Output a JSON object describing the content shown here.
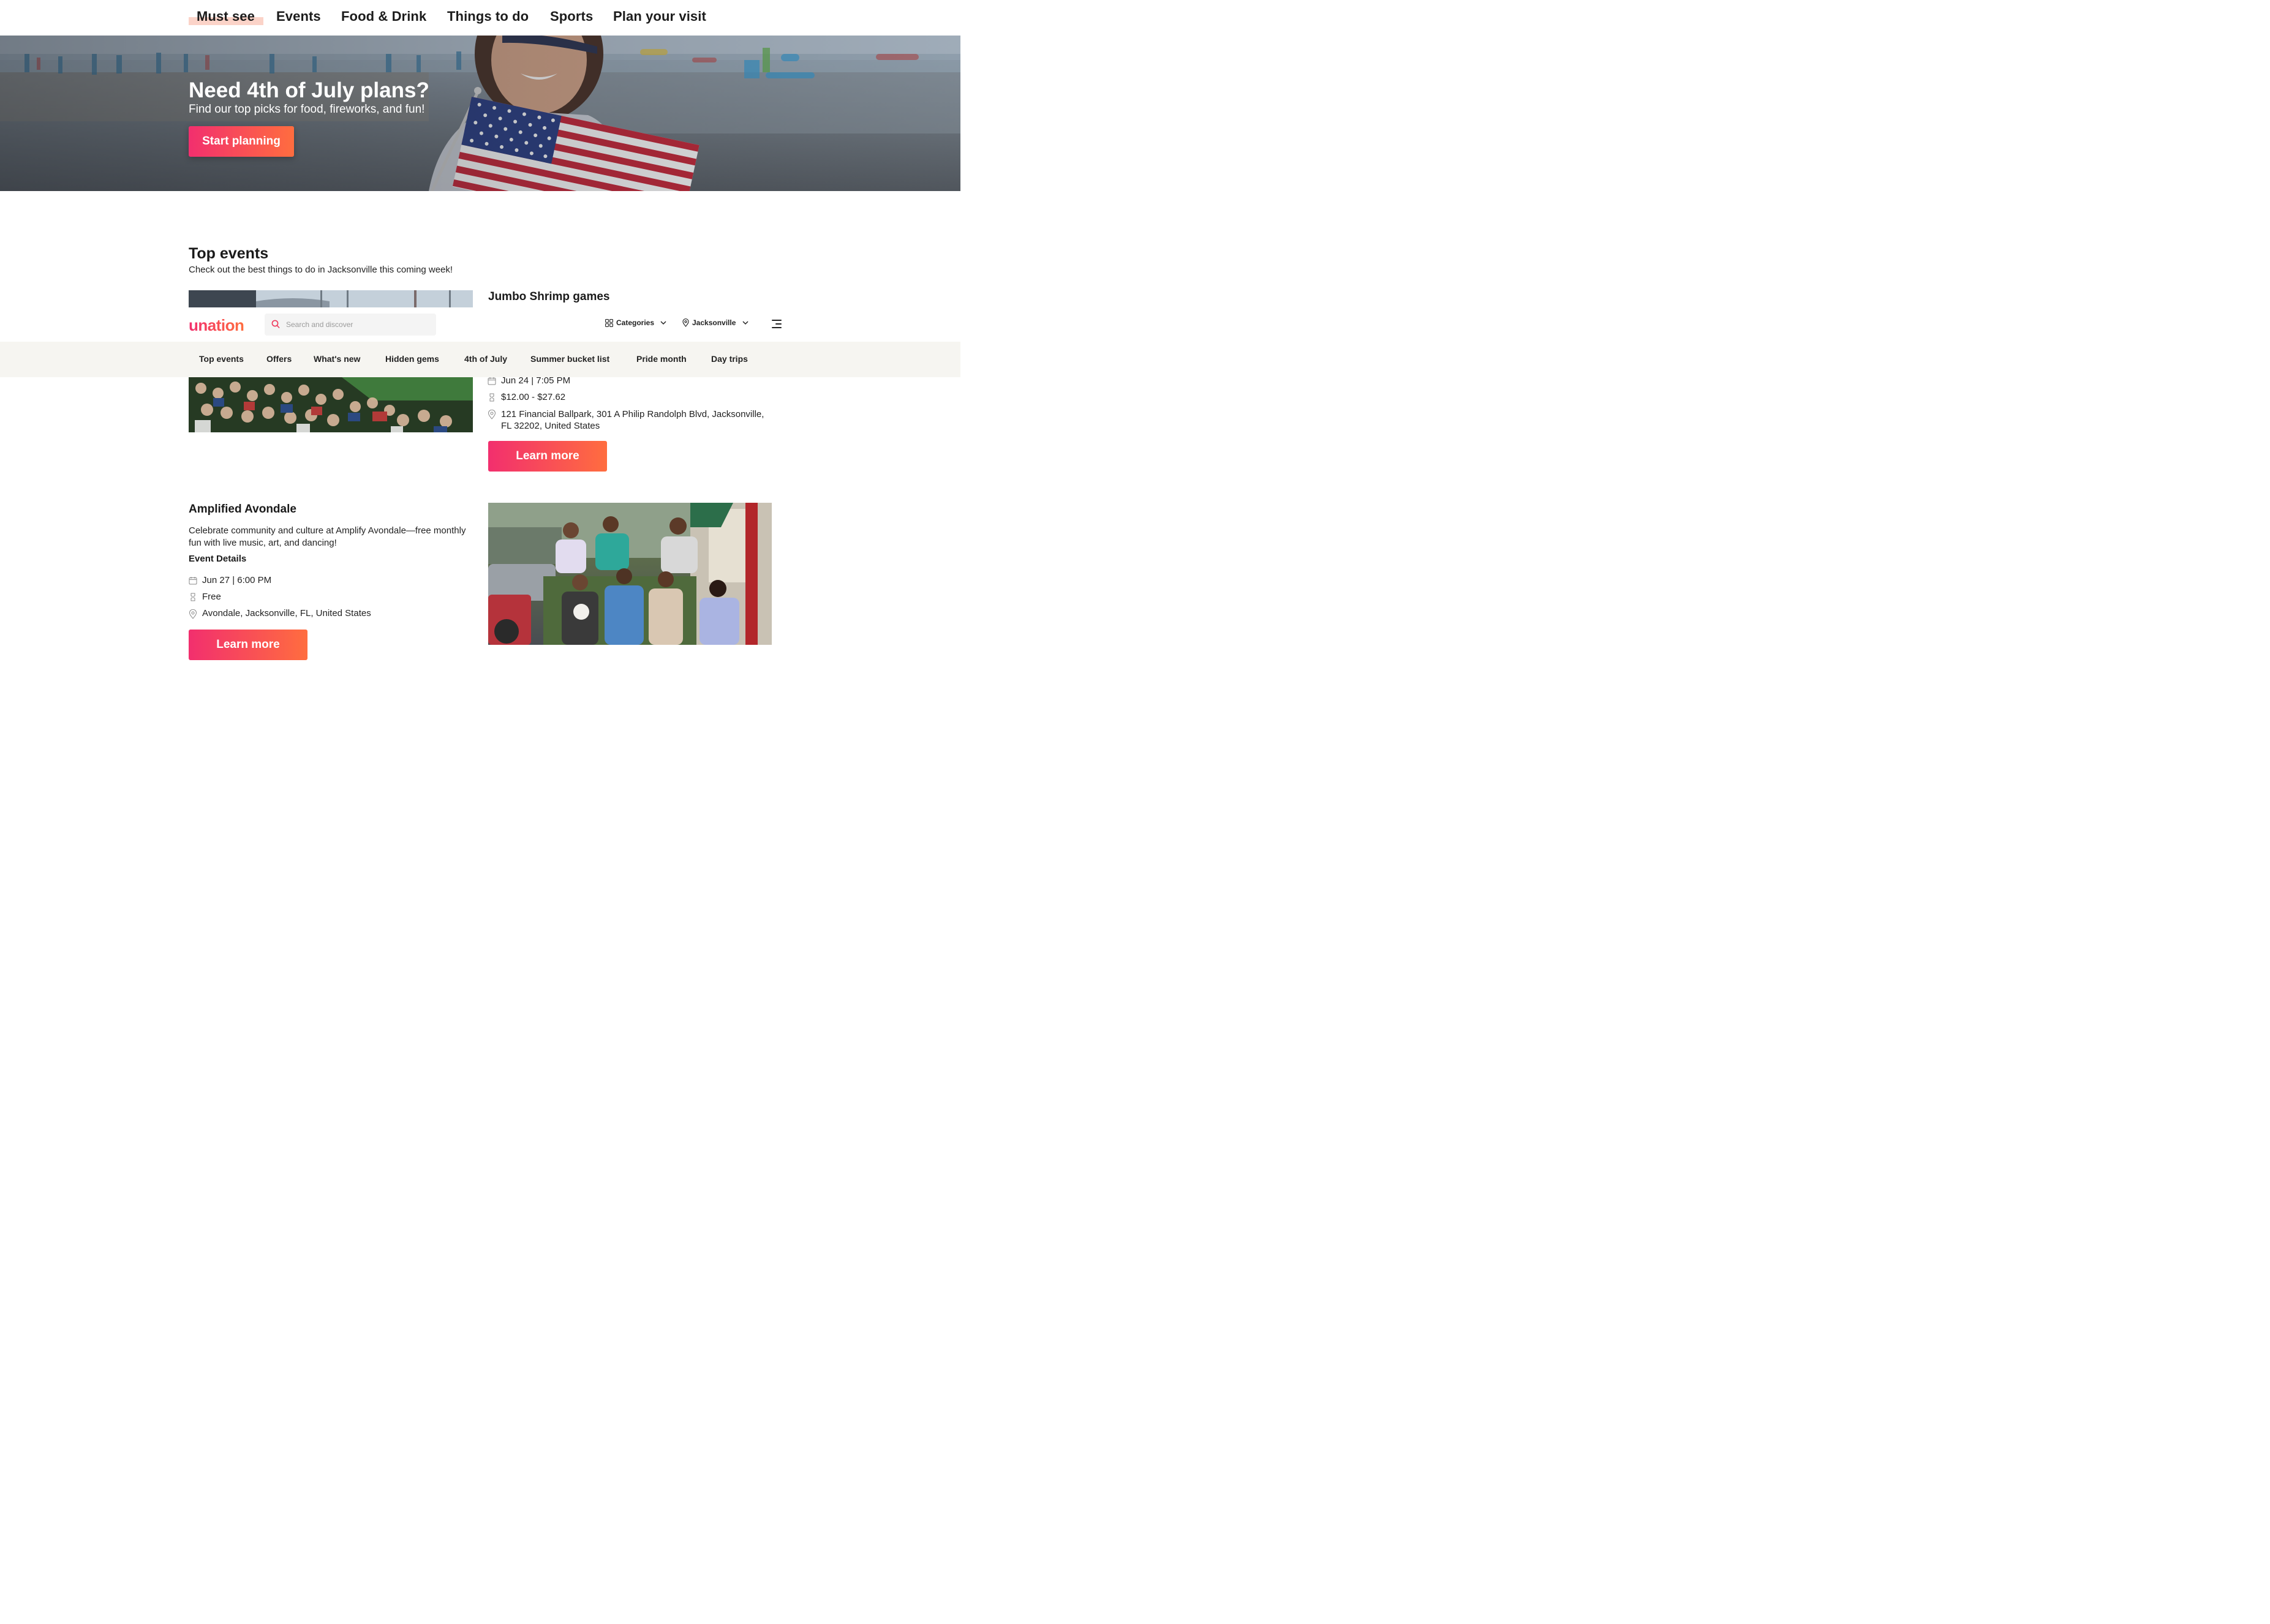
{
  "top_nav": {
    "items": [
      {
        "label": "Must see",
        "active": true
      },
      {
        "label": "Events"
      },
      {
        "label": "Food & Drink"
      },
      {
        "label": "Things to do"
      },
      {
        "label": "Sports"
      },
      {
        "label": "Plan your visit"
      }
    ]
  },
  "hero": {
    "title": "Need 4th of July plans?",
    "subtitle": "Find our top picks for food, fireworks, and fun!",
    "cta_label": "Start planning"
  },
  "header": {
    "logo_text": "unation",
    "search_placeholder": "Search and discover",
    "categories_label": "Categories",
    "location_label": "Jacksonville",
    "brand_gradient": [
      "#f22f6e",
      "#ff6d3f"
    ]
  },
  "sub_nav": {
    "items": [
      "Top events",
      "Offers",
      "What's new",
      "Hidden gems",
      "4th of July",
      "Summer bucket list",
      "Pride month",
      "Day trips"
    ]
  },
  "top_events": {
    "title": "Top events",
    "subtitle": "Check out the best things to do in Jacksonville this coming week!",
    "events": [
      {
        "title": "Jumbo Shrimp games",
        "date": "Jun 24 | 7:05 PM",
        "price": "$12.00 - $27.62",
        "location": "121 Financial Ballpark, 301 A Philip Randolph Blvd, Jacksonville, FL 32202, United States",
        "cta_label": "Learn more"
      },
      {
        "title": "Amplified Avondale",
        "description": "Celebrate community and culture at Amplify Avondale—free monthly fun with live music, art, and dancing!",
        "details_heading": "Event Details",
        "date": "Jun 27 | 6:00 PM",
        "price": "Free",
        "location": "Avondale, Jacksonville, FL, United States",
        "cta_label": "Learn more"
      }
    ]
  }
}
